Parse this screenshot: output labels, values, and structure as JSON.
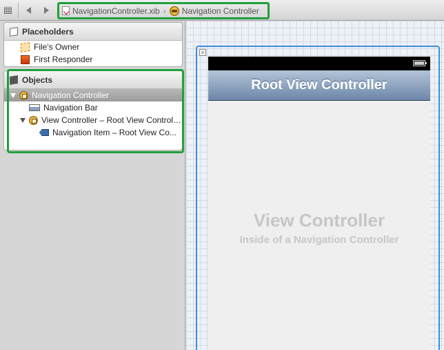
{
  "jump_bar": {
    "file": "NavigationController.xib",
    "object": "Navigation Controller"
  },
  "outline": {
    "placeholders": {
      "title": "Placeholders",
      "items": [
        {
          "label": "File's Owner",
          "icon": "files-owner-icon"
        },
        {
          "label": "First Responder",
          "icon": "first-responder-icon"
        }
      ]
    },
    "objects": {
      "title": "Objects",
      "items": [
        {
          "label": "Navigation Controller",
          "icon": "navigation-controller-icon",
          "selected": true,
          "expanded": true
        },
        {
          "label": "Navigation Bar",
          "icon": "navigation-bar-icon"
        },
        {
          "label": "View Controller – Root View Controller",
          "icon": "view-controller-icon",
          "expanded": true
        },
        {
          "label": "Navigation Item – Root View Co...",
          "icon": "navigation-item-icon"
        }
      ]
    }
  },
  "canvas": {
    "nav_title": "Root View Controller",
    "view_title": "View Controller",
    "view_subtitle": "Inside of a Navigation Controller",
    "close_glyph": "×"
  },
  "colors": {
    "highlight": "#1fa03c",
    "selection_border": "#3b8de0",
    "nav_bar_top": "#b3c4d8",
    "nav_bar_bottom": "#6d87a9"
  }
}
